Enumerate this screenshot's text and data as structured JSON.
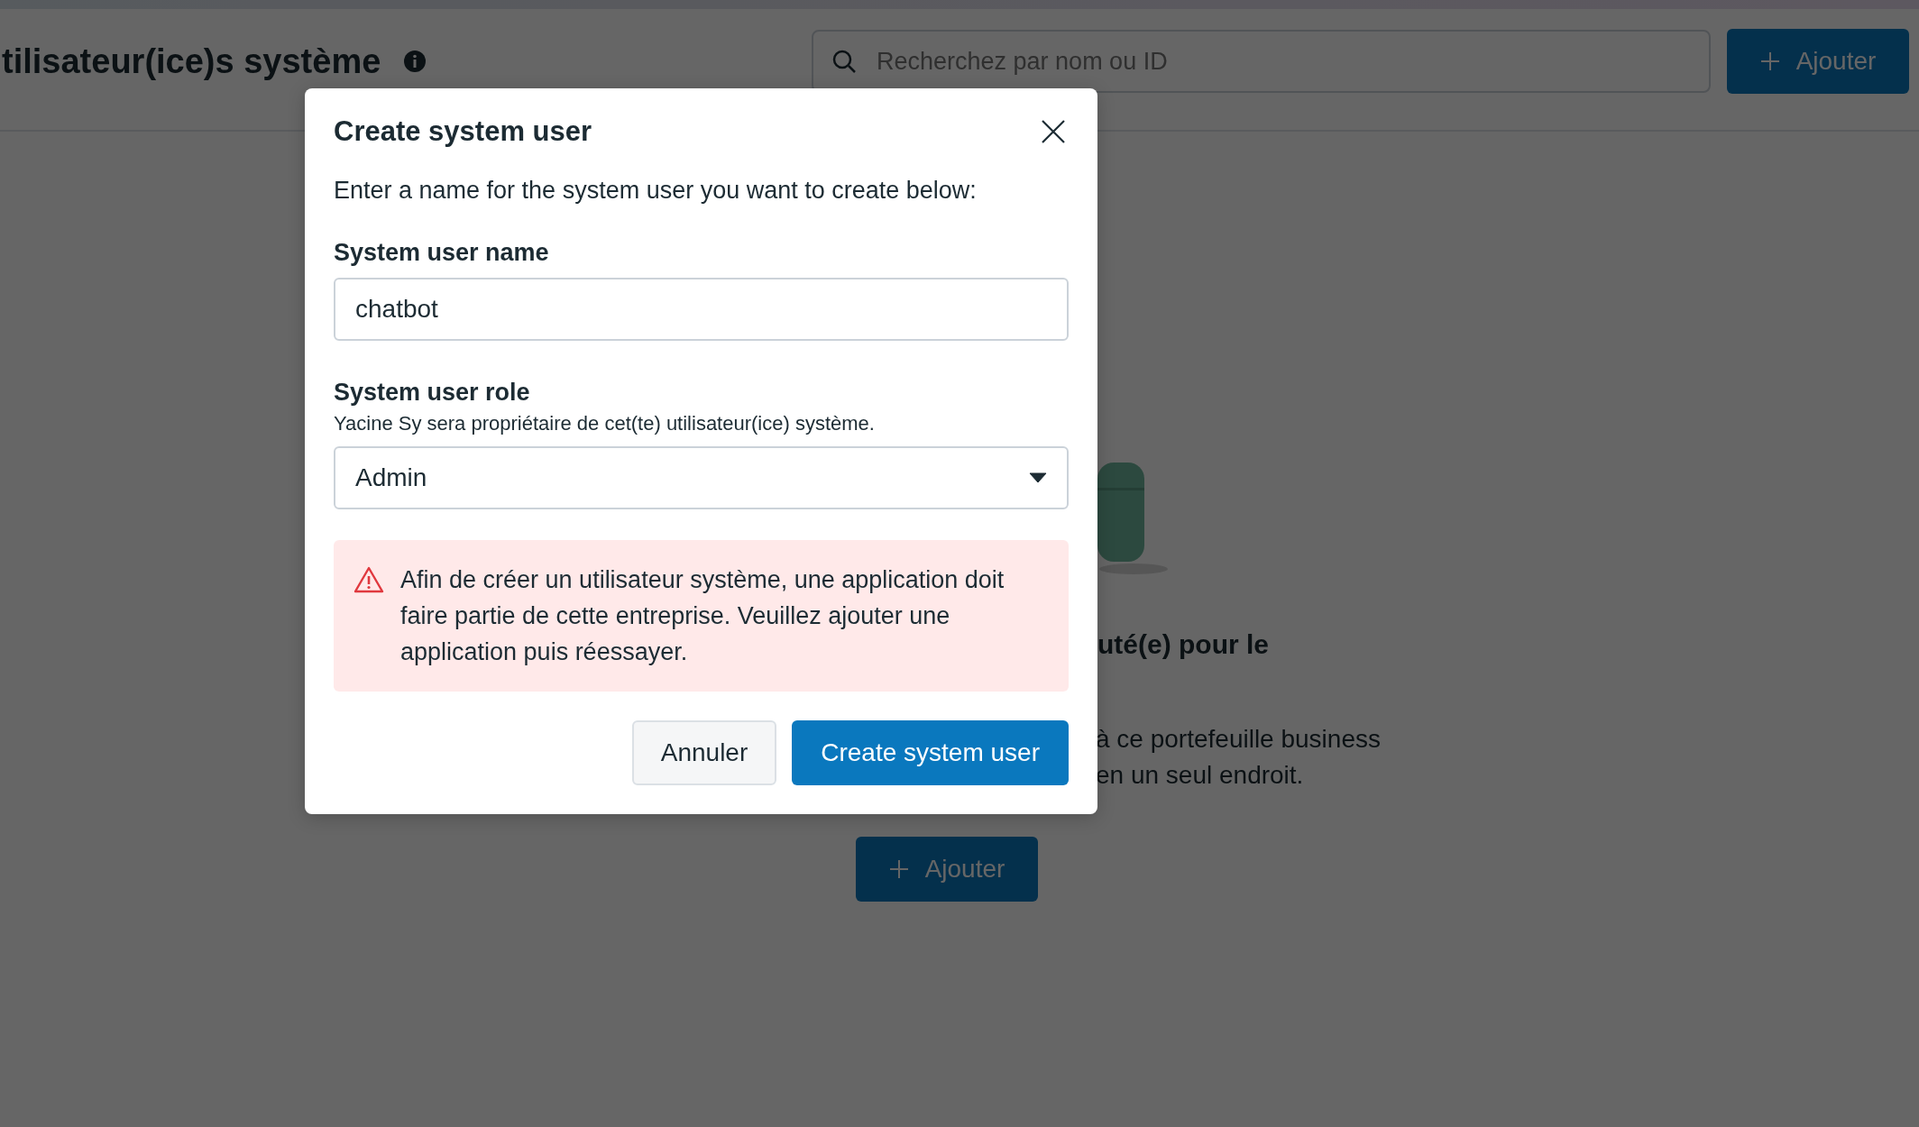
{
  "page": {
    "title": "tilisateur(ice)s système",
    "search": {
      "placeholder": "Recherchez par nom ou ID"
    },
    "add_button": "Ajouter",
    "empty_state": {
      "heading": "uté(e) pour le",
      "description_lines": [
        "à ce portefeuille business",
        "en un seul endroit."
      ],
      "add_button": "Ajouter"
    }
  },
  "dialog": {
    "title": "Create system user",
    "intro": "Enter a name for the system user you want to create below:",
    "name_field": {
      "label": "System user name",
      "value": "chatbot"
    },
    "role_field": {
      "label": "System user role",
      "hint": "Yacine Sy sera propriétaire de cet(te) utilisateur(ice) système.",
      "value": "Admin"
    },
    "alert": {
      "kind": "error",
      "text": "Afin de créer un utilisateur système, une application doit faire partie de cette entreprise. Veuillez ajouter une application puis réessayer."
    },
    "buttons": [
      {
        "label": "Annuler",
        "kind": "secondary"
      },
      {
        "label": "Create system user",
        "kind": "primary"
      }
    ]
  }
}
